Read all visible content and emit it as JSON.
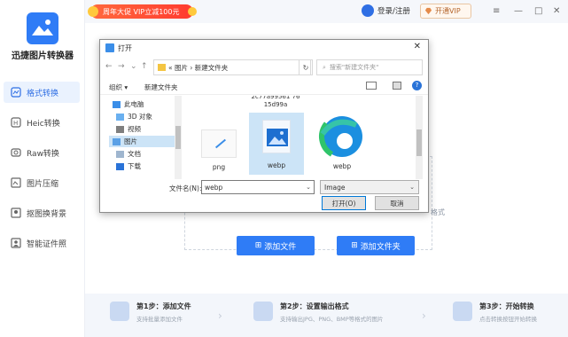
{
  "app": {
    "name": "迅捷图片转换器",
    "nav": [
      {
        "label": "格式转换",
        "active": true,
        "icon": "image-convert-icon"
      },
      {
        "label": "Heic转换",
        "active": false,
        "icon": "heic-icon"
      },
      {
        "label": "Raw转换",
        "active": false,
        "icon": "raw-icon"
      },
      {
        "label": "图片压缩",
        "active": false,
        "icon": "compress-icon"
      },
      {
        "label": "抠图换背景",
        "active": false,
        "icon": "cutout-icon"
      },
      {
        "label": "智能证件照",
        "active": false,
        "icon": "id-photo-icon"
      }
    ]
  },
  "topbar": {
    "promo": "周年大促 VIP立减100元",
    "user": "登录/注册",
    "vip": "开通VIP",
    "minimize": "—",
    "maximize": "□",
    "close": "✕"
  },
  "main": {
    "hint": "格式",
    "add_file": "添加文件",
    "add_folder": "添加文件夹"
  },
  "steps": [
    {
      "title": "第1步：添加文件",
      "sub": "支持批量添加文件"
    },
    {
      "title": "第2步：设置输出格式",
      "sub": "支持输出JPG、PNG、BMP等格式的图片"
    },
    {
      "title": "第3步：开始转换",
      "sub": "点击转换按钮开始转换"
    }
  ],
  "dialog": {
    "title": "打开",
    "close": "✕",
    "nav": {
      "back": "←",
      "forward": "→",
      "down": "⌄",
      "up": "↑"
    },
    "path": [
      "图片",
      "新建文件夹"
    ],
    "path_sep": "›",
    "path_prefix": "«",
    "search_placeholder": "搜索\"新建文件夹\"",
    "refresh": "↻",
    "organize": "组织 ▾",
    "new_folder": "新建文件夹",
    "help": "?",
    "tree": [
      {
        "label": "此电脑",
        "icon": "computer-icon",
        "selected": false
      },
      {
        "label": "3D 对象",
        "icon": "3d-objects-icon",
        "selected": false
      },
      {
        "label": "视频",
        "icon": "video-folder-icon",
        "selected": false
      },
      {
        "label": "图片",
        "icon": "pictures-folder-icon",
        "selected": true
      },
      {
        "label": "文档",
        "icon": "documents-folder-icon",
        "selected": false
      },
      {
        "label": "下载",
        "icon": "downloads-folder-icon",
        "selected": false
      }
    ],
    "top_file_name": "2c77a99561 76 15d99a",
    "files": [
      {
        "name": "png",
        "icon": "png-file-icon",
        "selected": false
      },
      {
        "name": "webp",
        "icon": "image-file-icon",
        "selected": true
      },
      {
        "name": "webp",
        "icon": "edge-browser-icon",
        "selected": false
      }
    ],
    "filename_label": "文件名(N):",
    "filename_value": "webp",
    "filetype": "Image",
    "open_button": "打开(O)",
    "cancel_button": "取消"
  }
}
